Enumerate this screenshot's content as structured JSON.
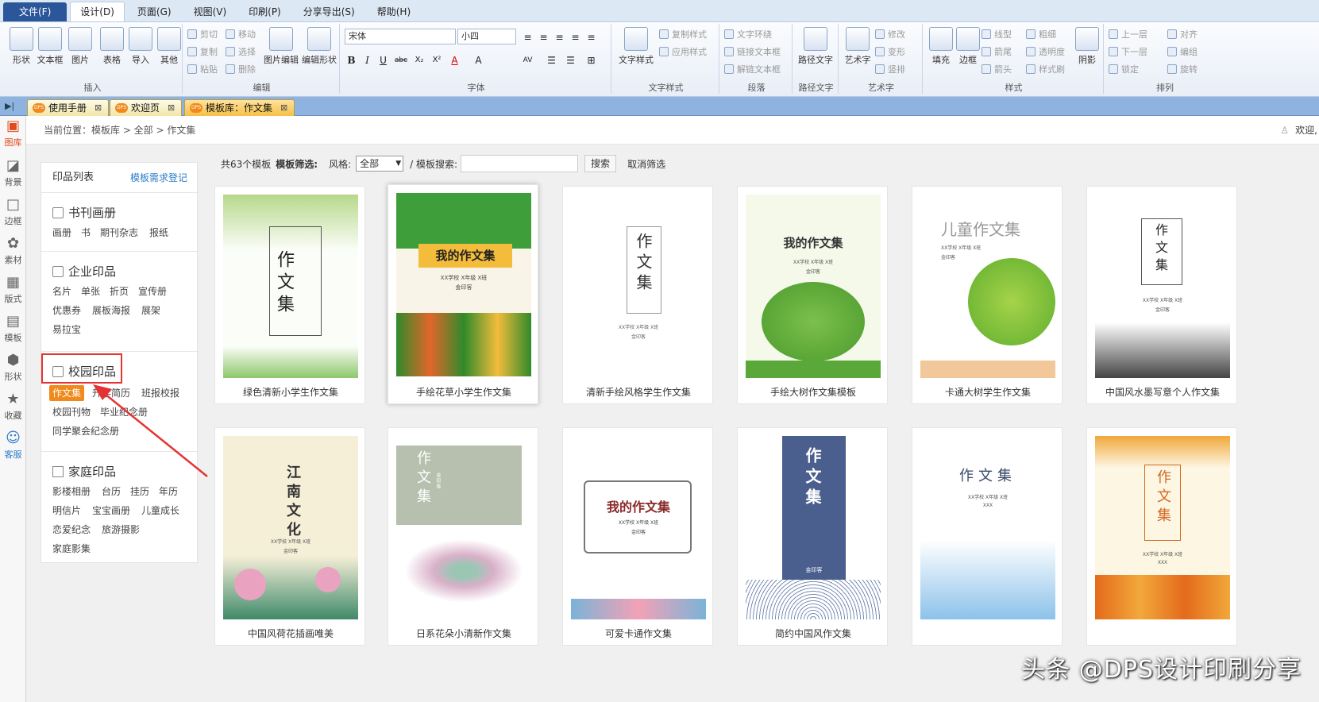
{
  "menubar": {
    "items": [
      "文件(F)",
      "设计(D)",
      "页面(G)",
      "视图(V)",
      "印刷(P)",
      "分享导出(S)",
      "帮助(H)"
    ]
  },
  "ribbon": {
    "insert": {
      "label": "插入",
      "buttons": [
        "形状",
        "文本框",
        "图片",
        "表格",
        "导入",
        "其他"
      ]
    },
    "edit": {
      "label": "编辑",
      "cut": "剪切",
      "move": "移动",
      "copy": "复制",
      "select": "选择",
      "paste": "粘贴",
      "delete": "删除",
      "picture_edit": "图片编辑",
      "edit_shape": "编辑形状"
    },
    "font": {
      "label": "字体",
      "family": "宋体",
      "size": "小四",
      "bold": "B",
      "italic": "I",
      "underline": "U",
      "strike": "abc",
      "sub": "X₂",
      "sup": "X²"
    },
    "text_style": {
      "label": "文字样式",
      "text_style": "文字样式",
      "copy_style": "复制样式",
      "apply_style": "应用样式"
    },
    "paragraph": {
      "label": "段落",
      "wrap": "文字环绕",
      "link": "链接文本框",
      "unlink": "解链文本框"
    },
    "path_text": {
      "label": "路径文字",
      "btn": "路径文字"
    },
    "art": {
      "label": "艺术字",
      "btn": "艺术字",
      "modify": "修改",
      "transform": "变形",
      "vertical": "竖排"
    },
    "style": {
      "label": "样式",
      "fill": "填充",
      "border": "边框",
      "line_type": "线型",
      "line_weight": "粗细",
      "arrow_tail": "箭尾",
      "transparency": "透明度",
      "arrow_head": "箭头",
      "format_brush": "样式刷",
      "shadow": "阴影"
    },
    "arrange": {
      "label": "排列",
      "up": "上一层",
      "align": "对齐",
      "down": "下一层",
      "group": "编组",
      "lock": "锁定",
      "rotate": "旋转"
    }
  },
  "doc_tabs": [
    {
      "label": "使用手册"
    },
    {
      "label": "欢迎页"
    },
    {
      "label": "模板库：作文集"
    }
  ],
  "iconbar": [
    "图库",
    "背景",
    "边框",
    "素材",
    "版式",
    "模板",
    "形状",
    "收藏",
    "客服"
  ],
  "breadcrumb": "当前位置：模板库 > 全部 > 作文集",
  "welcome": "欢迎,",
  "catalog": {
    "title": "印品列表",
    "request": "模板需求登记",
    "sections": [
      {
        "title": "书刊画册",
        "items": [
          "画册",
          "书",
          "期刊杂志",
          "报纸"
        ]
      },
      {
        "title": "企业印品",
        "items": [
          "名片",
          "单张",
          "折页",
          "宣传册",
          "优惠券",
          "展板海报",
          "展架",
          "易拉宝"
        ]
      },
      {
        "title": "校园印品",
        "items": [
          "作文集",
          "升学简历",
          "班报校报",
          "校园刊物",
          "毕业纪念册",
          "同学聚会纪念册"
        ]
      },
      {
        "title": "家庭印品",
        "items": [
          "影楼相册",
          "台历",
          "挂历",
          "年历",
          "明信片",
          "宝宝画册",
          "儿童成长",
          "恋爱纪念",
          "旅游摄影",
          "家庭影集"
        ]
      }
    ]
  },
  "filter": {
    "count": "共63个模板",
    "filter_label": "模板筛选:",
    "style_label": "风格:",
    "style_value": "全部",
    "search_label": "/ 模板搜索:",
    "search_btn": "搜索",
    "clear": "取消筛选"
  },
  "templates": [
    {
      "title": "绿色清新小学生作文集",
      "cover": "作文集"
    },
    {
      "title": "手绘花草小学生作文集",
      "cover": "我的作文集",
      "sub": "XX学校 X年级 X班",
      "author": "金印客"
    },
    {
      "title": "清新手绘风格学生作文集",
      "cover": "作文集",
      "sub": "XX学校 X年级 X班",
      "author": "金印客"
    },
    {
      "title": "手绘大树作文集模板",
      "cover": "我的作文集",
      "sub": "XX学校 X年级 X班",
      "author": "金印客"
    },
    {
      "title": "卡通大树学生作文集",
      "cover": "儿童作文集",
      "sub": "XX学校 X年级 X班",
      "author": "金印客"
    },
    {
      "title": "中国风水墨写意个人作文集",
      "cover": "作文集",
      "sub": "XX学校 X年级 X班",
      "author": "金印客"
    },
    {
      "title": "中国风荷花插画唯美",
      "cover": "江南文化",
      "sub": "XX学校 X年级 X班",
      "author": "金印客"
    },
    {
      "title": "日系花朵小清新作文集",
      "cover": "作文集",
      "author": "金印客"
    },
    {
      "title": "可爱卡通作文集",
      "cover": "我的作文集",
      "sub": "XX学校 X年级 X班",
      "author": "金印客"
    },
    {
      "title": "简约中国风作文集",
      "cover": "作文集",
      "author": "金印客"
    },
    {
      "title": "",
      "cover": "作文集",
      "sub": "XX学校 X年级 X班",
      "author": "XXX"
    },
    {
      "title": "",
      "cover": "作文集",
      "sub": "XX学校 X年级 X班",
      "author": "XXX"
    }
  ],
  "watermark": "头条 @DPS设计印刷分享"
}
